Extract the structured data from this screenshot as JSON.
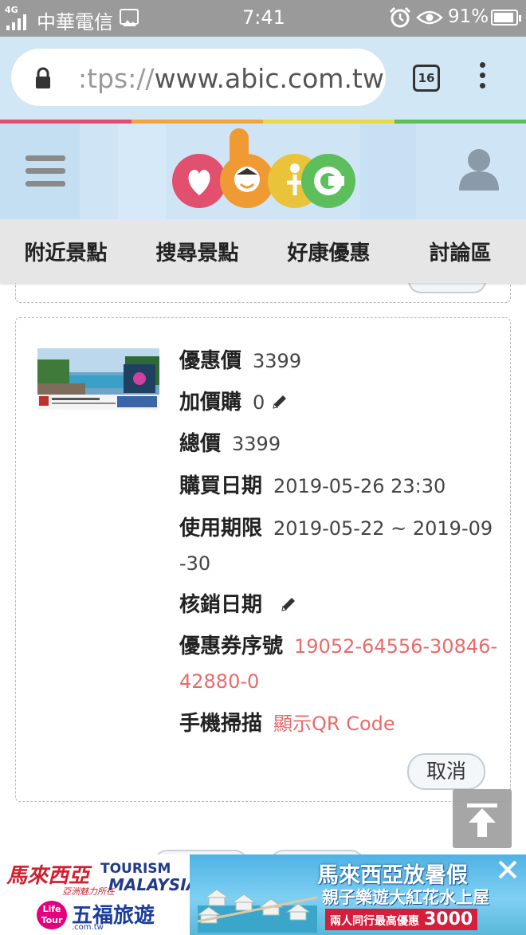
{
  "status_bar": {
    "network": "4G",
    "carrier": "中華電信",
    "time": "7:41",
    "battery_percent": "91%",
    "battery_level": 0.91
  },
  "browser": {
    "url_prefix": ":tps://",
    "url_main": "www.abic.com.tw",
    "tab_count": "16"
  },
  "nav": {
    "items": [
      "附近景點",
      "搜尋景點",
      "好康優惠",
      "討論區"
    ]
  },
  "coupon": {
    "price_label": "優惠價",
    "price_value": "3399",
    "addon_label": "加價購",
    "addon_value": "0",
    "total_label": "總價",
    "total_value": "3399",
    "purchase_date_label": "購買日期",
    "purchase_date_value": "2019-05-26 23:30",
    "validity_label": "使用期限",
    "validity_value": "2019-05-22 ~ 2019-09-30",
    "redeem_date_label": "核銷日期",
    "serial_label": "優惠券序號",
    "serial_value": "19052-64556-30846-42880-0",
    "scan_label": "手機掃描",
    "scan_link": "顯示QR Code",
    "cancel_button": "取消"
  },
  "ad": {
    "malaysia_cn": "馬來西亞",
    "malaysia_sub": "亞洲魅力所在",
    "tourism": "TOURISM",
    "malaysia_en": "MALAYSIA",
    "lifetour": "Life Tour",
    "wufu": "五福旅遊",
    "wufu_sub": ".com.tw",
    "headline": "馬來西亞放暑假",
    "subline": "親子樂遊大紅花水上屋",
    "promo_text": "兩人同行最高優惠",
    "promo_amount": "3000"
  },
  "colors": {
    "accent_link": "#ea6a6a",
    "stripe": [
      "#e24e6e",
      "#f0a640",
      "#e9d84a",
      "#5cbf5c"
    ],
    "logo_a": "#e2506f",
    "logo_b": "#f09a33",
    "logo_i": "#e9c43a",
    "logo_c": "#5cbf5c"
  }
}
